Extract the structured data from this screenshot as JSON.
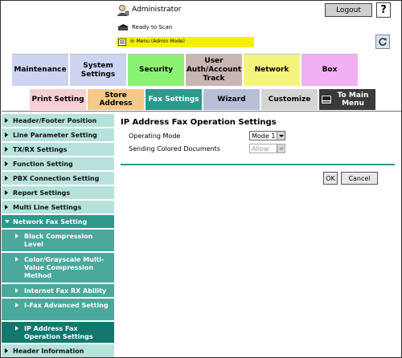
{
  "header": {
    "user_label": "Administrator",
    "logout_label": "Logout",
    "help_label": "?",
    "status_text": "Ready to Scan",
    "mode_text": "In Menu (Admin Mode)"
  },
  "main_tabs": [
    {
      "label": "Maintenance",
      "color": "#ccd4f2"
    },
    {
      "label": "System Settings",
      "color": "#ccd4f2"
    },
    {
      "label": "Security",
      "color": "#8cf274"
    },
    {
      "label": "User Auth/Account Track",
      "color": "#c9b5b2"
    },
    {
      "label": "Network",
      "color": "#f5f57d"
    },
    {
      "label": "Box",
      "color": "#f2b0f2"
    }
  ],
  "sub_tabs": [
    {
      "label": "Print Setting",
      "color": "#f5cfd1"
    },
    {
      "label": "Store Address",
      "color": "#f5c98a"
    },
    {
      "label": "Fax Settings",
      "color": "#2b9a8c",
      "active": true
    },
    {
      "label": "Wizard",
      "color": "#b8bfd8"
    },
    {
      "label": "Customize",
      "color": "#d4d4d4"
    },
    {
      "label": "To Main Menu",
      "color": "#3a3a3a"
    }
  ],
  "sidebar": {
    "items": [
      {
        "label": "Header/Footer Position"
      },
      {
        "label": "Line Parameter Setting"
      },
      {
        "label": "TX/RX Settings"
      },
      {
        "label": "Function Setting"
      },
      {
        "label": "PBX Connection Setting"
      },
      {
        "label": "Report Settings"
      },
      {
        "label": "Multi Line Settings"
      },
      {
        "label": "Network Fax Setting"
      },
      {
        "label": "Black Compression Level"
      },
      {
        "label": "Color/Grayscale Multi-Value Compression Method"
      },
      {
        "label": "Internet Fax RX Ability"
      },
      {
        "label": "I-Fax Advanced Setting"
      },
      {
        "label": "IP Address Fax Operation Settings"
      },
      {
        "label": "Header Information"
      }
    ]
  },
  "content": {
    "title": "IP Address Fax Operation Settings",
    "fields": [
      {
        "label": "Operating Mode",
        "value": "Mode 1",
        "enabled": true
      },
      {
        "label": "Sending Colored Documents",
        "value": "Allow",
        "enabled": false
      }
    ],
    "ok_label": "OK",
    "cancel_label": "Cancel"
  }
}
